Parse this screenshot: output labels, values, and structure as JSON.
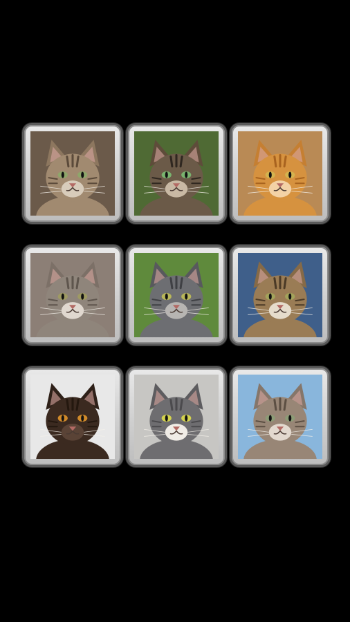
{
  "screen": {
    "background": "#000000"
  },
  "tiles": [
    {
      "icon": "tabby-cat-photo-icon",
      "background": "#6b5a4a",
      "fur": "#a18a70",
      "stripe": "#5b4a3a",
      "eye": "#8ea66a",
      "ear": "#8d775f",
      "muzzle": "#d8ccbb"
    },
    {
      "icon": "dark-tabby-cat-photo-icon",
      "background": "#4f6a34",
      "fur": "#6b5a48",
      "stripe": "#2f2720",
      "eye": "#79b36e",
      "ear": "#5e4c3a",
      "muzzle": "#c9b9a4"
    },
    {
      "icon": "hissing-orange-cat-photo-icon",
      "background": "#b98a55",
      "fur": "#d6923f",
      "stripe": "#a8631f",
      "eye": "#d4b34f",
      "ear": "#c57f32",
      "muzzle": "#f3d2a6"
    },
    {
      "icon": "grumpy-grey-tabby-cat-photo-icon",
      "background": "#8c7f76",
      "fur": "#8f857b",
      "stripe": "#5e554d",
      "eye": "#9e9a63",
      "ear": "#7c7067",
      "muzzle": "#e0d8cf"
    },
    {
      "icon": "prowling-grey-cat-photo-icon",
      "background": "#5f8a3c",
      "fur": "#6d6e72",
      "stripe": "#3f4044",
      "eye": "#b9b75a",
      "ear": "#58595d",
      "muzzle": "#b7b5b2"
    },
    {
      "icon": "rolling-tabby-cat-photo-icon",
      "background": "#3f5f8a",
      "fur": "#9a7c55",
      "stripe": "#4b3a26",
      "eye": "#a3a35b",
      "ear": "#866a47",
      "muzzle": "#e6dccb"
    },
    {
      "icon": "hissing-brown-cat-photo-icon",
      "background": "#e8e8e8",
      "fur": "#3b2a20",
      "stripe": "#24180f",
      "eye": "#d08a2a",
      "ear": "#2e2018",
      "muzzle": "#5a4336"
    },
    {
      "icon": "grey-white-cat-photo-icon",
      "background": "#c7c6c3",
      "fur": "#6e6d70",
      "stripe": "#4b4a4d",
      "eye": "#d3d24e",
      "ear": "#5d5c5f",
      "muzzle": "#f0ece6"
    },
    {
      "icon": "long-hair-tabby-cat-photo-icon",
      "background": "#89b6dc",
      "fur": "#988676",
      "stripe": "#5c4f43",
      "eye": "#8d9b76",
      "ear": "#85766a",
      "muzzle": "#e3d9cf"
    }
  ]
}
